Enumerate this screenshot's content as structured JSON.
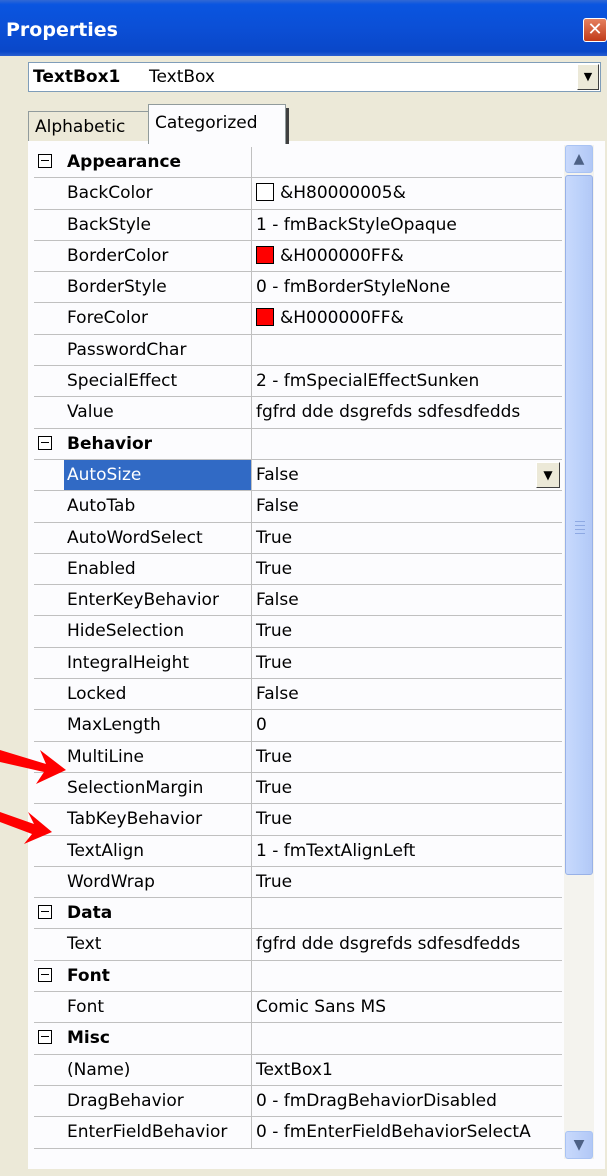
{
  "window": {
    "title": "Properties",
    "close_glyph": "✕"
  },
  "object_selector": {
    "name": "TextBox1",
    "type": "TextBox",
    "dropdown_icon": "chevron-down-icon"
  },
  "tabs": [
    {
      "label": "Alphabetic",
      "active": false
    },
    {
      "label": "Categorized",
      "active": true
    }
  ],
  "categories": [
    {
      "label": "Appearance",
      "rows": [
        {
          "name": "BackColor",
          "value": "&H80000005&",
          "swatch": "#ffffff"
        },
        {
          "name": "BackStyle",
          "value": "1 - fmBackStyleOpaque"
        },
        {
          "name": "BorderColor",
          "value": "&H000000FF&",
          "swatch": "#ff0000"
        },
        {
          "name": "BorderStyle",
          "value": "0 - fmBorderStyleNone"
        },
        {
          "name": "ForeColor",
          "value": "&H000000FF&",
          "swatch": "#ff0000"
        },
        {
          "name": "PasswordChar",
          "value": ""
        },
        {
          "name": "SpecialEffect",
          "value": "2 - fmSpecialEffectSunken"
        },
        {
          "name": "Value",
          "value": "fgfrd dde dsgrefds sdfesdfedds"
        }
      ]
    },
    {
      "label": "Behavior",
      "rows": [
        {
          "name": "AutoSize",
          "value": "False",
          "selected": true
        },
        {
          "name": "AutoTab",
          "value": "False"
        },
        {
          "name": "AutoWordSelect",
          "value": "True"
        },
        {
          "name": "Enabled",
          "value": "True"
        },
        {
          "name": "EnterKeyBehavior",
          "value": "False"
        },
        {
          "name": "HideSelection",
          "value": "True"
        },
        {
          "name": "IntegralHeight",
          "value": "True"
        },
        {
          "name": "Locked",
          "value": "False"
        },
        {
          "name": "MaxLength",
          "value": "0"
        },
        {
          "name": "MultiLine",
          "value": "True"
        },
        {
          "name": "SelectionMargin",
          "value": "True"
        },
        {
          "name": "TabKeyBehavior",
          "value": "True"
        },
        {
          "name": "TextAlign",
          "value": "1 - fmTextAlignLeft"
        },
        {
          "name": "WordWrap",
          "value": "True"
        }
      ]
    },
    {
      "label": "Data",
      "rows": [
        {
          "name": "Text",
          "value": "fgfrd dde dsgrefds sdfesdfedds"
        }
      ]
    },
    {
      "label": "Font",
      "rows": [
        {
          "name": "Font",
          "value": "Comic Sans MS"
        }
      ]
    },
    {
      "label": "Misc",
      "rows": [
        {
          "name": "(Name)",
          "value": "TextBox1"
        },
        {
          "name": "DragBehavior",
          "value": "0 - fmDragBehaviorDisabled"
        },
        {
          "name": "EnterFieldBehavior",
          "value": "0 - fmEnterFieldBehaviorSelectA"
        }
      ]
    }
  ],
  "colors": {
    "selection": "#316ac5",
    "titlebar": "#0a55e0",
    "annotation_arrow": "#ff0000"
  }
}
